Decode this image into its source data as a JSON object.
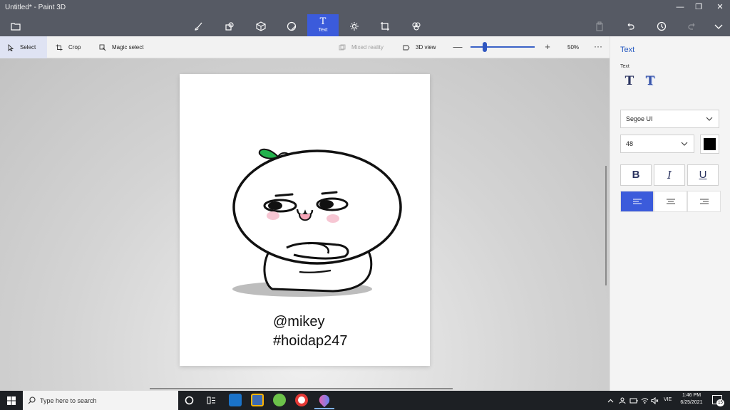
{
  "window": {
    "title": "Untitled* - Paint 3D",
    "controls": [
      "minimize-icon",
      "restore-icon",
      "close-icon"
    ]
  },
  "toolbar": {
    "active_tool_glyph": "T",
    "active_tool_label": "Text",
    "tools": [
      "open-menu-icon",
      "brushes-icon",
      "2d-shapes-icon",
      "3d-shapes-icon",
      "stickers-icon",
      "text-icon",
      "effects-icon",
      "canvas-icon",
      "3d-library-icon"
    ],
    "right_tools": [
      "paste-icon",
      "undo-icon",
      "history-icon",
      "redo-icon",
      "expand-icon"
    ]
  },
  "subbar": {
    "select_label": "Select",
    "crop_label": "Crop",
    "magic_select_label": "Magic select",
    "mixed_reality_label": "Mixed reality",
    "view3d_label": "3D view",
    "zoom_minus": "—",
    "zoom_plus": "+",
    "zoom_value": "50%",
    "zoom_fraction": 0.22,
    "more": "···"
  },
  "canvas": {
    "line1": "@mikey",
    "line2": "#hoidap247"
  },
  "panel": {
    "title": "Text",
    "section_label": "Text",
    "text_type_2d": "T",
    "text_type_3d": "T",
    "font_family": "Segoe UI",
    "font_size": "48",
    "text_color": "#000000",
    "bold": "B",
    "italic": "I",
    "underline": "U",
    "alignment_selected": "left",
    "accent": "#3b5bdb"
  },
  "taskbar": {
    "search_placeholder": "Type here to search",
    "language": "VIE",
    "time": "1:46 PM",
    "date": "6/25/2021",
    "notification_count": "15"
  }
}
